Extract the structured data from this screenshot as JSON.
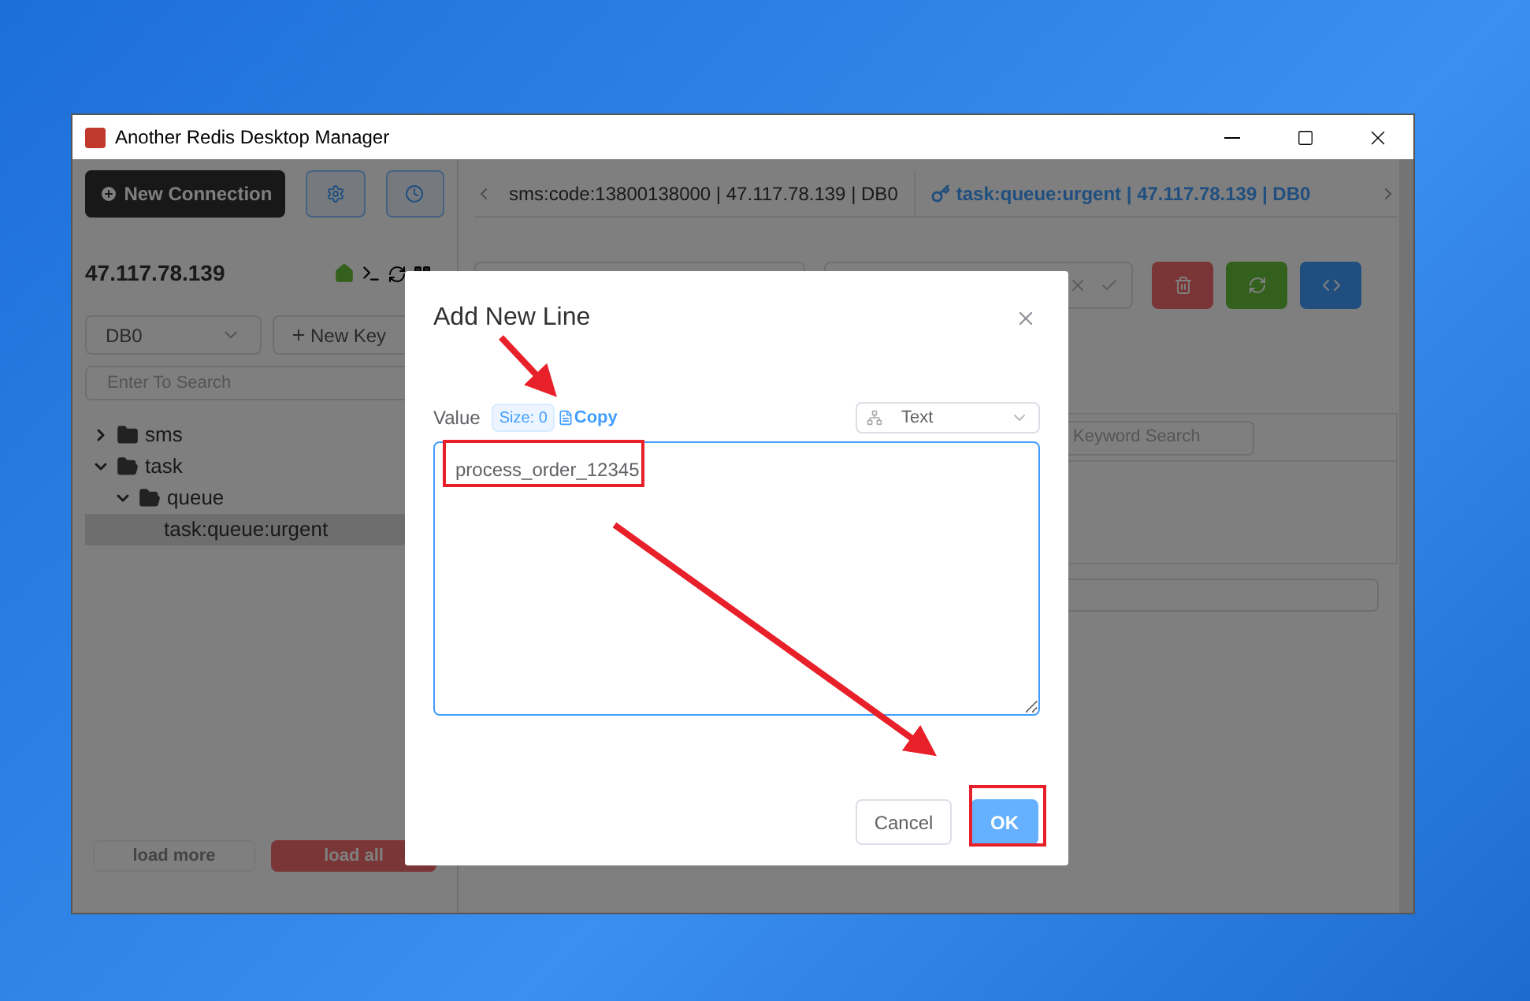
{
  "window": {
    "title": "Another Redis Desktop Manager"
  },
  "sidebar": {
    "new_connection": "New Connection",
    "host": "47.117.78.139",
    "db_select": "DB0",
    "new_key": "New Key",
    "search": {
      "placeholder": "Enter To Search"
    },
    "tree": [
      {
        "label": "sms",
        "expanded": false,
        "selected": false
      },
      {
        "label": "task",
        "expanded": true,
        "selected": false,
        "children": [
          {
            "label": "queue",
            "expanded": true,
            "selected": false,
            "children": [
              {
                "label": "task:queue:urgent",
                "selected": true
              }
            ]
          }
        ]
      }
    ],
    "load_more": "load more",
    "load_all": "load all"
  },
  "tabs": [
    {
      "label": "sms:code:13800138000 | 47.117.78.139 | DB0",
      "selected": false
    },
    {
      "label": "task:queue:urgent | 47.117.78.139 | DB0",
      "selected": true
    }
  ],
  "keyword_search": {
    "placeholder": "Keyword Search"
  },
  "dialog": {
    "title": "Add New Line",
    "value_label": "Value",
    "size_badge": "Size: 0",
    "copy_link": "Copy",
    "format_select": "Text",
    "value": "process_order_12345",
    "cancel": "Cancel",
    "ok": "OK"
  }
}
